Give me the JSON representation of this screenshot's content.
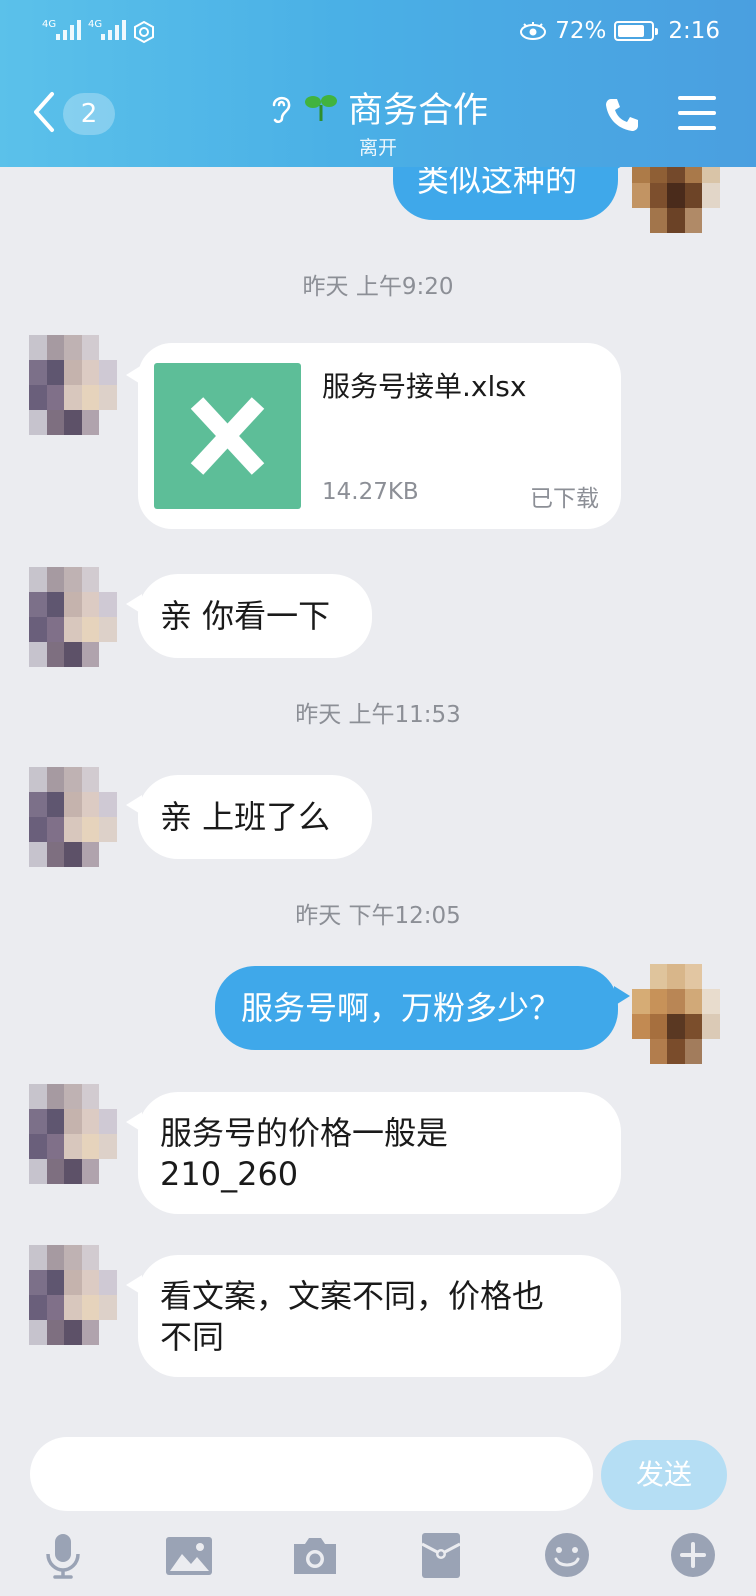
{
  "status_bar": {
    "network_1": "4G",
    "network_2": "4G",
    "battery": "72%",
    "time": "2:16"
  },
  "header": {
    "unread_count": "2",
    "title": "商务合作",
    "subtitle": "离开",
    "bg_color": "#4aaee6"
  },
  "messages": [
    {
      "type": "text",
      "direction": "out",
      "text": "类似这种的"
    },
    {
      "type": "timestamp",
      "text": "昨天 上午9:20"
    },
    {
      "type": "file",
      "direction": "in",
      "file_name": "服务号接单.xlsx",
      "file_size": "14.27KB",
      "file_status": "已下载",
      "icon": "excel-x-icon"
    },
    {
      "type": "text",
      "direction": "in",
      "text": "亲 你看一下"
    },
    {
      "type": "timestamp",
      "text": "昨天 上午11:53"
    },
    {
      "type": "text",
      "direction": "in",
      "text": "亲 上班了么"
    },
    {
      "type": "timestamp",
      "text": "昨天 下午12:05"
    },
    {
      "type": "text",
      "direction": "out",
      "text": "服务号啊，万粉多少？"
    },
    {
      "type": "text",
      "direction": "in",
      "text_line1": "服务号的价格一般是",
      "text_line2": "210_260"
    },
    {
      "type": "text",
      "direction": "in",
      "text_line1": "看文案，文案不同，价格也",
      "text_line2": "不同"
    }
  ],
  "input": {
    "value": "",
    "send_label": "发送"
  },
  "toolbar": [
    "microphone-icon",
    "image-icon",
    "camera-icon",
    "red-packet-icon",
    "emoji-icon",
    "plus-icon"
  ],
  "colors": {
    "outgoing_bubble": "#3fa8ea",
    "incoming_bubble": "#ffffff",
    "background": "#ebecf0",
    "excel_green": "#5dbe98"
  }
}
